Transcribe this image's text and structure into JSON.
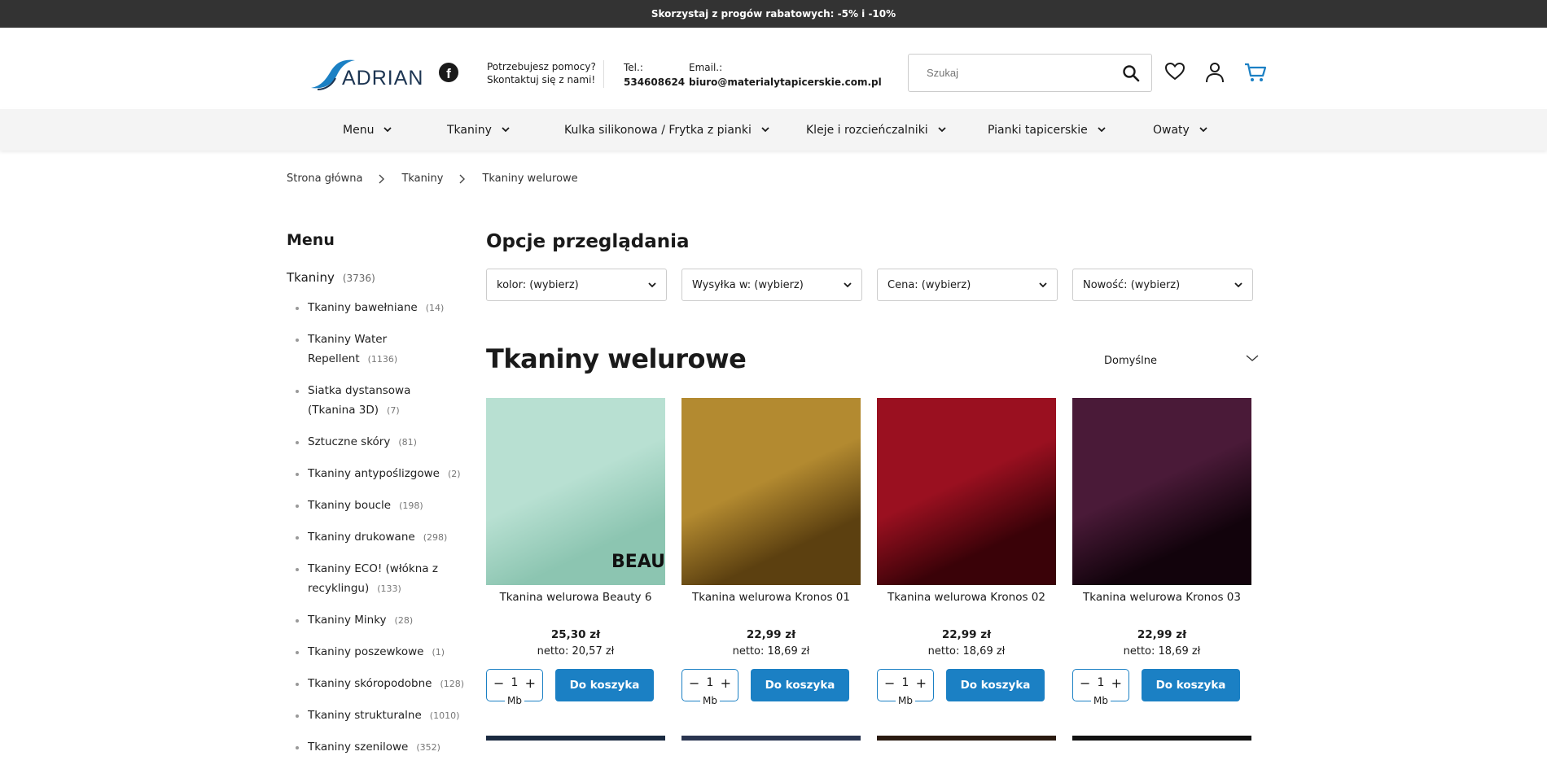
{
  "topbar": {
    "promo": "Skorzystaj z progów rabatowych: -5% i -10%"
  },
  "header": {
    "logo_text": "ADRIAN",
    "help_line1": "Potrzebujesz pomocy?",
    "help_line2": "Skontaktuj się z nami!",
    "tel_label": "Tel.:",
    "tel_value": "534608624",
    "email_label": "Email.:",
    "email_value": "biuro@materialytapicerskie.com.pl",
    "search_placeholder": "Szukaj",
    "icons": [
      "facebook-icon",
      "search-icon",
      "heart-icon",
      "user-icon",
      "cart-icon"
    ]
  },
  "nav": {
    "items": [
      {
        "label": "Menu"
      },
      {
        "label": "Tkaniny"
      },
      {
        "label": "Kulka silikonowa / Frytka z pianki"
      },
      {
        "label": "Kleje i rozcieńczalniki"
      },
      {
        "label": "Pianki tapicerskie"
      },
      {
        "label": "Owaty"
      }
    ]
  },
  "breadcrumb": [
    "Strona główna",
    "Tkaniny",
    "Tkaniny welurowe"
  ],
  "sidebar": {
    "title": "Menu",
    "top_label": "Tkaniny",
    "top_count": "(3736)",
    "items": [
      {
        "label": "Tkaniny bawełniane",
        "count": "(14)"
      },
      {
        "label": "Tkaniny Water Repellent",
        "count": "(1136)"
      },
      {
        "label": "Siatka dystansowa (Tkanina 3D)",
        "count": "(7)"
      },
      {
        "label": "Sztuczne skóry",
        "count": "(81)"
      },
      {
        "label": "Tkaniny antypoślizgowe",
        "count": "(2)"
      },
      {
        "label": "Tkaniny boucle",
        "count": "(198)"
      },
      {
        "label": "Tkaniny drukowane",
        "count": "(298)"
      },
      {
        "label": "Tkaniny ECO! (włókna z recyklingu)",
        "count": "(133)"
      },
      {
        "label": "Tkaniny Minky",
        "count": "(28)"
      },
      {
        "label": "Tkaniny poszewkowe",
        "count": "(1)"
      },
      {
        "label": "Tkaniny skóropodobne",
        "count": "(128)"
      },
      {
        "label": "Tkaniny strukturalne",
        "count": "(1010)"
      },
      {
        "label": "Tkaniny szenilowe",
        "count": "(352)"
      }
    ]
  },
  "main": {
    "options_title": "Opcje przeglądania",
    "filters": [
      "kolor: (wybierz)",
      "Wysyłka w: (wybierz)",
      "Cena: (wybierz)",
      "Nowość: (wybierz)"
    ],
    "category_title": "Tkaniny welurowe",
    "sort_label": "Domyślne",
    "products": [
      {
        "name": "Tkanina welurowa Beauty 6",
        "price": "25,30 zł",
        "net": "netto: 20,57 zł",
        "qty": "1",
        "unit": "Mb",
        "button": "Do koszyka",
        "colors": [
          "#b8e0d2",
          "#8cc5b1"
        ],
        "overlay": "BEAU"
      },
      {
        "name": "Tkanina welurowa Kronos 01",
        "price": "22,99 zł",
        "net": "netto: 18,69 zł",
        "qty": "1",
        "unit": "Mb",
        "button": "Do koszyka",
        "colors": [
          "#b38a30",
          "#5c4010"
        ],
        "overlay": ""
      },
      {
        "name": "Tkanina welurowa Kronos 02",
        "price": "22,99 zł",
        "net": "netto: 18,69 zł",
        "qty": "1",
        "unit": "Mb",
        "button": "Do koszyka",
        "colors": [
          "#9a1020",
          "#3a0208"
        ],
        "overlay": ""
      },
      {
        "name": "Tkanina welurowa Kronos 03",
        "price": "22,99 zł",
        "net": "netto: 18,69 zł",
        "qty": "1",
        "unit": "Mb",
        "button": "Do koszyka",
        "colors": [
          "#4a1a38",
          "#12030c"
        ],
        "overlay": ""
      }
    ]
  },
  "colors": {
    "accent": "#1b80c4",
    "topbar": "#333333",
    "nav_bg": "#f4f4f4"
  }
}
